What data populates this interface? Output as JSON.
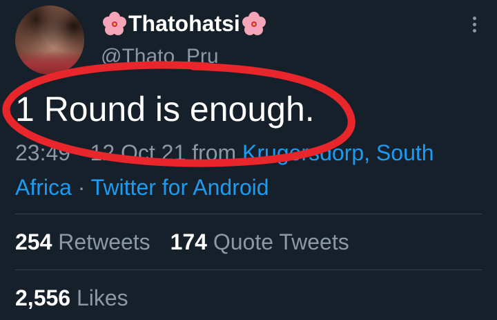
{
  "user": {
    "display_name": "Thatohatsi",
    "handle": "@Thato_Pru",
    "avatar_icon": "profile-photo",
    "name_emoji_icon": "hibiscus-icon"
  },
  "tweet": {
    "text": "1 Round is enough.",
    "time": "23:49",
    "separator": "·",
    "date": "12 Oct 21",
    "from_label": "from",
    "location": "Krugersdorp, South Africa",
    "client": "Twitter for Android"
  },
  "stats": {
    "retweets": {
      "count": "254",
      "label": "Retweets"
    },
    "quote_tweets": {
      "count": "174",
      "label": "Quote Tweets"
    },
    "likes": {
      "count": "2,556",
      "label": "Likes"
    }
  },
  "colors": {
    "background": "#15202b",
    "link": "#1d9bf0",
    "muted": "#8b98a5",
    "annotation": "#e8262b"
  }
}
